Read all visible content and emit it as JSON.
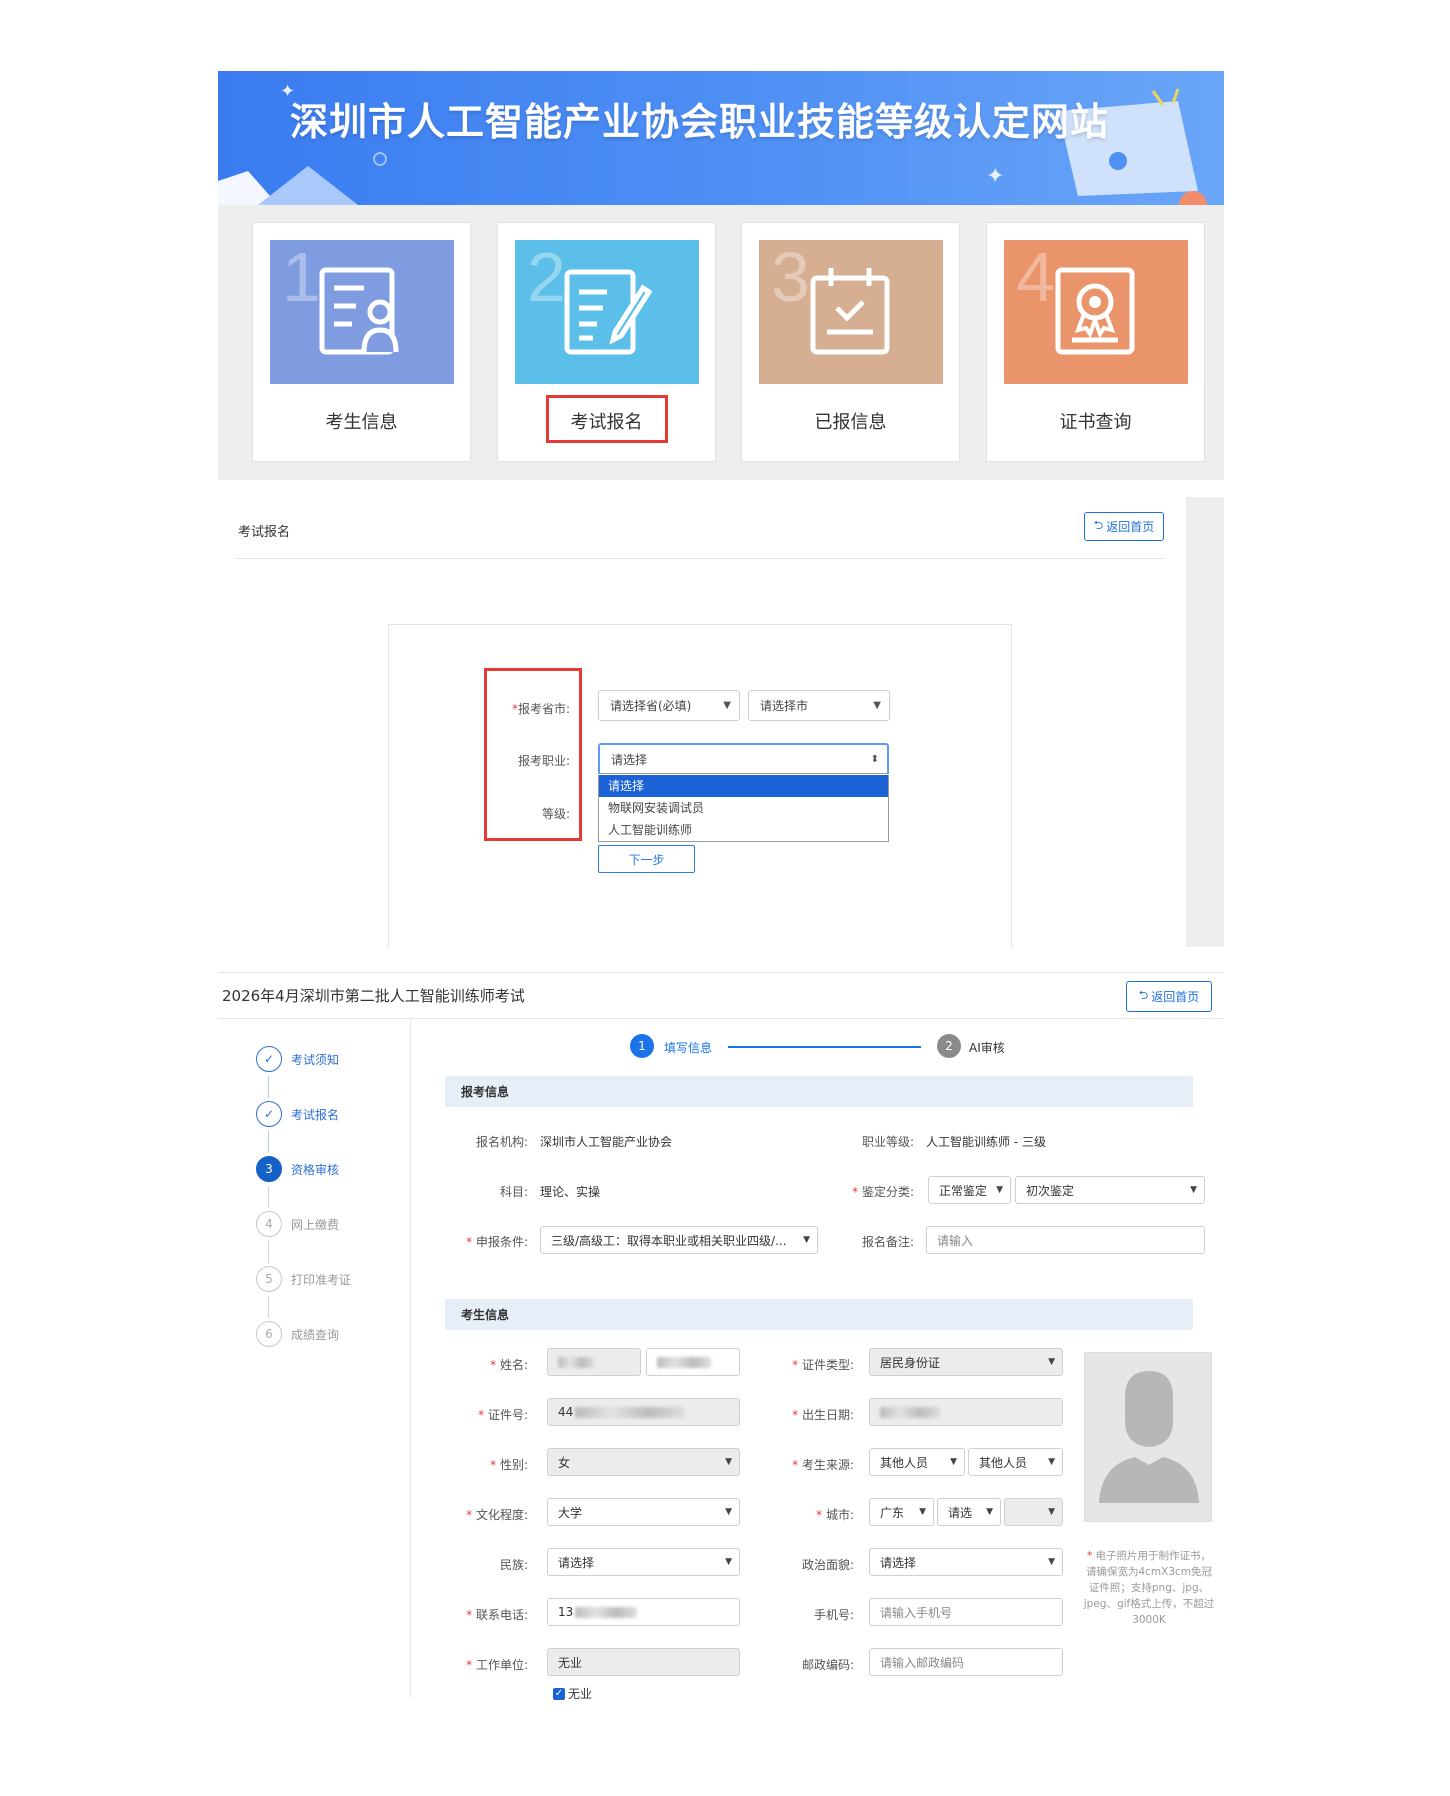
{
  "banner": {
    "title": "深圳市人工智能产业协会职业技能等级认定网站"
  },
  "tiles": [
    {
      "num": "1",
      "label": "考生信息",
      "color": "#7f9ce0",
      "icon": "profile-card-icon"
    },
    {
      "num": "2",
      "label": "考试报名",
      "color": "#5bbfe9",
      "icon": "edit-form-icon"
    },
    {
      "num": "3",
      "label": "已报信息",
      "color": "#d6ae92",
      "icon": "calendar-check-icon"
    },
    {
      "num": "4",
      "label": "证书查询",
      "color": "#e9946a",
      "icon": "certificate-icon"
    }
  ],
  "registration": {
    "heading": "考试报名",
    "home_button": "返回首页",
    "province_label": "报考省市:",
    "province_placeholder": "请选择省(必填)",
    "city_placeholder": "请选择市",
    "occupation_label": "报考职业:",
    "occupation_value": "请选择",
    "level_label": "等级:",
    "options": [
      "请选择",
      "物联网安装调试员",
      "人工智能训练师"
    ],
    "next_button": "下一步"
  },
  "exam": {
    "title": "2026年4月深圳市第二批人工智能训练师考试",
    "home_button": "返回首页",
    "steps": [
      {
        "n": "1",
        "label": "考试须知",
        "state": "done"
      },
      {
        "n": "2",
        "label": "考试报名",
        "state": "done"
      },
      {
        "n": "3",
        "label": "资格审核",
        "state": "current"
      },
      {
        "n": "4",
        "label": "网上缴费",
        "state": "todo"
      },
      {
        "n": "5",
        "label": "打印准考证",
        "state": "todo"
      },
      {
        "n": "6",
        "label": "成绩查询",
        "state": "todo"
      }
    ],
    "progress": [
      {
        "n": "1",
        "label": "填写信息"
      },
      {
        "n": "2",
        "label": "AI审核"
      }
    ],
    "section_apply": "报考信息",
    "section_candidate": "考生信息",
    "apply": {
      "org_label": "报名机构:",
      "org_value": "深圳市人工智能产业协会",
      "level_label": "职业等级:",
      "level_value": "人工智能训练师 - 三级",
      "subject_label": "科目:",
      "subject_value": "理论、实操",
      "category_label": "鉴定分类:",
      "category_value1": "正常鉴定",
      "category_value2": "初次鉴定",
      "condition_label": "申报条件:",
      "condition_value": "三级/高级工：取得本职业或相关职业四级/...",
      "remark_label": "报名备注:",
      "remark_placeholder": "请输入"
    },
    "candidate": {
      "name_label": "姓名:",
      "id_type_label": "证件类型:",
      "id_type_value": "居民身份证",
      "id_no_label": "证件号:",
      "id_no_prefix": "44",
      "birth_label": "出生日期:",
      "gender_label": "性别:",
      "gender_value": "女",
      "source_label": "考生来源:",
      "source_value1": "其他人员",
      "source_value2": "其他人员",
      "edu_label": "文化程度:",
      "edu_value": "大学",
      "city_label": "城市:",
      "city_value1": "广东",
      "city_value2": "请选",
      "nation_label": "民族:",
      "nation_value": "请选择",
      "politics_label": "政治面貌:",
      "politics_value": "请选择",
      "phone_label": "联系电话:",
      "phone_prefix": "13",
      "mobile_label": "手机号:",
      "mobile_placeholder": "请输入手机号",
      "work_label": "工作单位:",
      "work_value": "无业",
      "postcode_label": "邮政编码:",
      "postcode_placeholder": "请输入邮政编码",
      "unemployed_check": "无业",
      "photo_note": "电子照片用于制作证书，请确保宽为4cmX3cm免冠证件照；支持png、jpg、jpeg、gif格式上传，不超过3000K"
    }
  }
}
